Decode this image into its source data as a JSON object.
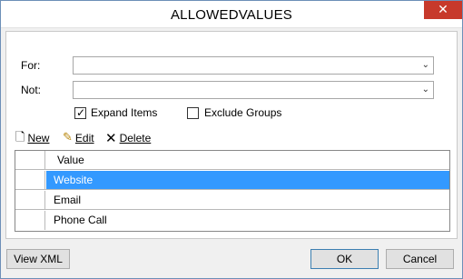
{
  "window": {
    "title": "ALLOWEDVALUES",
    "close_symbol": "✕"
  },
  "form": {
    "for_label": "For:",
    "for_value": "",
    "not_label": "Not:",
    "not_value": "",
    "expand_items": {
      "label": "Expand Items",
      "checked": true
    },
    "exclude_groups": {
      "label": "Exclude Groups",
      "checked": false
    }
  },
  "toolbar": {
    "new_label": "New",
    "edit_label": "Edit",
    "delete_label": "Delete"
  },
  "grid": {
    "column_header": "Value",
    "rows": [
      "Website",
      "Email",
      "Phone Call"
    ],
    "selected_row": 0
  },
  "footer": {
    "view_xml_label": "View XML",
    "ok_label": "OK",
    "cancel_label": "Cancel"
  }
}
